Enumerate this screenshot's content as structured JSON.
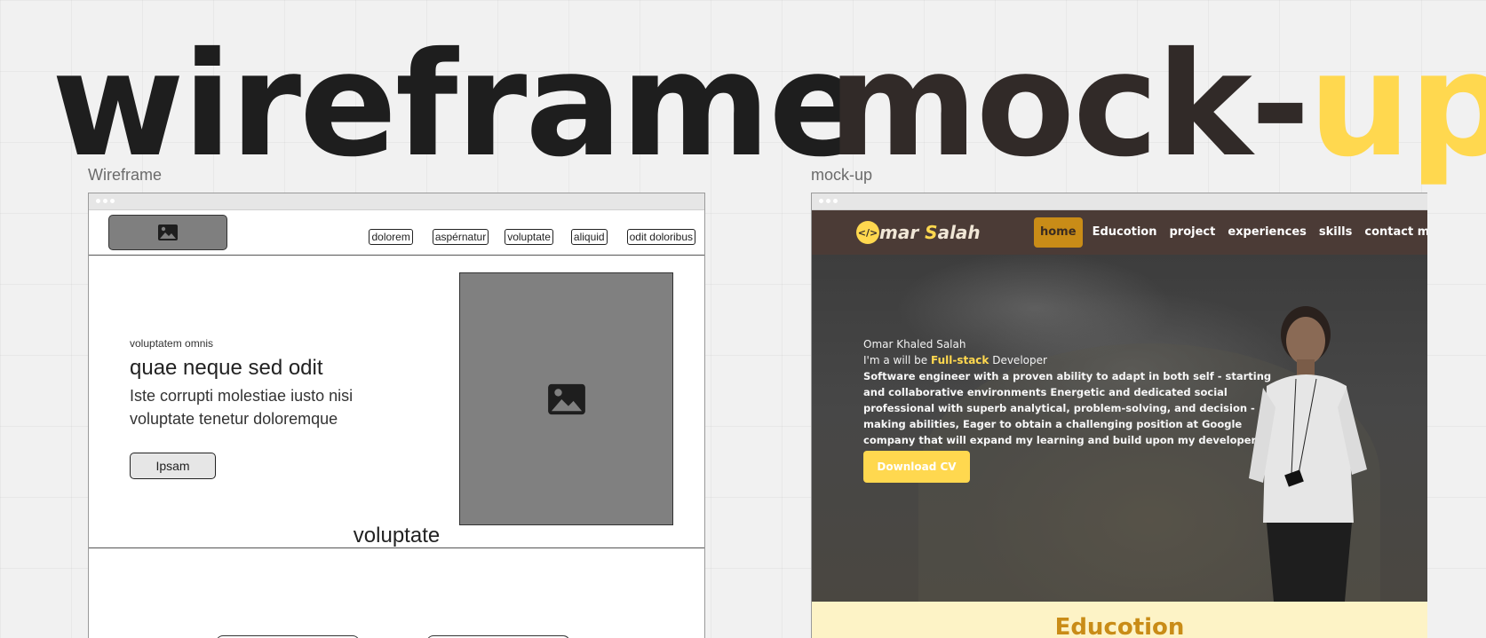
{
  "headings": {
    "wireframe": "wireframe",
    "mockup_prefix": "mock-",
    "mockup_accent": "up"
  },
  "frames": {
    "wireframe_label": "Wireframe",
    "mockup_label": "mock-up"
  },
  "wireframe": {
    "nav": [
      "dolorem",
      "aspérnatur",
      "voluptate",
      "aliquid",
      "odit doloribus"
    ],
    "hero": {
      "small": "voluptatem omnis",
      "heading": "quae neque sed odit",
      "body": "Iste corrupti molestiae iusto nisi voluptate tenetur doloremque",
      "button": "Ipsam"
    },
    "section_title": "voluptate"
  },
  "mockup": {
    "logo_icon": "</>",
    "logo_text_1": "mar ",
    "logo_text_accent": "S",
    "logo_text_2": "alah",
    "nav": [
      "home",
      "Educotion",
      "project",
      "experiences",
      "skills",
      "contact me"
    ],
    "active_nav": "home",
    "hero": {
      "name": "Omar Khaled Salah",
      "role_prefix": "I'm a will be ",
      "role_accent": "Full-stack",
      "role_suffix": " Developer",
      "description": "Software engineer with a proven ability to adapt in both self - starting and collaborative environments Energetic and dedicated social professional with superb analytical, problem-solving, and decision - making abilities, Eager to obtain a challenging position at Google company that will expand my learning and build upon my developer skills",
      "cta": "Download CV"
    },
    "section_title": "Educotion"
  },
  "colors": {
    "accent_yellow": "#ffd84f",
    "dark_brown": "#4b3b36",
    "active_nav_bg": "#c98c17",
    "section_bg": "#fdf3c6"
  }
}
